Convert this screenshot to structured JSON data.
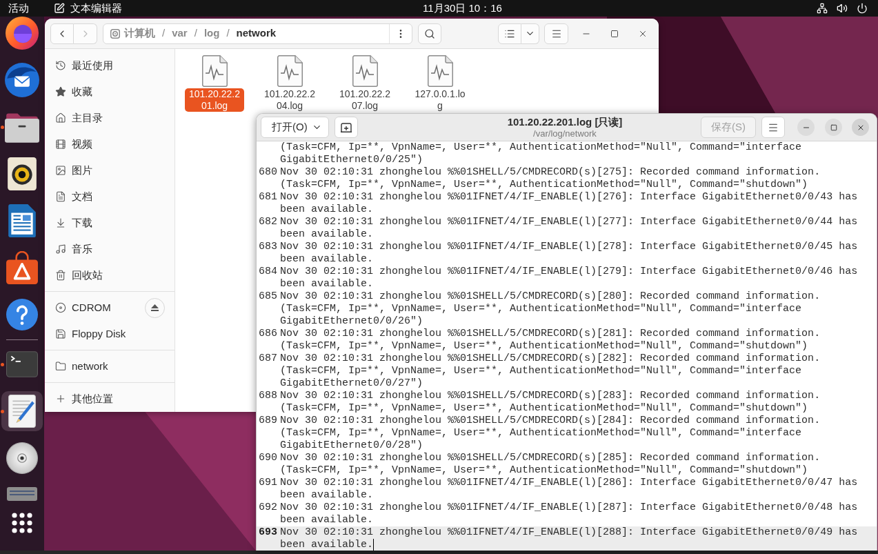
{
  "top_bar": {
    "activities": "活动",
    "app_menu": "文本编辑器",
    "clock": "11月30日 10：16"
  },
  "dock": {
    "groups": [
      {
        "items": [
          {
            "kind": "browser",
            "running": false,
            "selected": false
          },
          {
            "kind": "mail",
            "running": false,
            "selected": false
          },
          {
            "kind": "files",
            "running": true,
            "selected": false
          },
          {
            "kind": "music_player",
            "running": false,
            "selected": false
          },
          {
            "kind": "writer",
            "running": false,
            "selected": false
          },
          {
            "kind": "app_store",
            "running": false,
            "selected": false
          },
          {
            "kind": "help",
            "running": false,
            "selected": false
          }
        ]
      },
      {
        "items": [
          {
            "kind": "terminal",
            "running": true,
            "selected": false
          },
          {
            "kind": "text_editor",
            "running": true,
            "selected": true
          },
          {
            "kind": "disc",
            "running": false,
            "selected": false
          },
          {
            "kind": "drive",
            "running": false,
            "selected": false
          }
        ]
      }
    ]
  },
  "file_manager": {
    "nav_buttons": [
      {
        "kind": "back",
        "disabled": false
      },
      {
        "kind": "forward",
        "disabled": true
      }
    ],
    "path": {
      "segments": [
        {
          "label": "计算机",
          "selected": false
        },
        {
          "label": "var",
          "selected": false
        },
        {
          "label": "log",
          "selected": false
        },
        {
          "label": "network",
          "selected": true
        }
      ],
      "separators": [
        "/",
        "/",
        "/"
      ]
    },
    "sidebar": {
      "places": [
        {
          "kind": "recent",
          "label": "最近使用",
          "selected": false
        },
        {
          "kind": "starred",
          "label": "收藏",
          "selected": false
        },
        {
          "kind": "home",
          "label": "主目录",
          "selected": false
        },
        {
          "kind": "videos",
          "label": "视频",
          "selected": false
        },
        {
          "kind": "pictures",
          "label": "图片",
          "selected": false
        },
        {
          "kind": "documents",
          "label": "文档",
          "selected": false
        },
        {
          "kind": "downloads",
          "label": "下载",
          "selected": false
        },
        {
          "kind": "music",
          "label": "音乐",
          "selected": false
        },
        {
          "kind": "trash",
          "label": "回收站",
          "selected": false
        }
      ],
      "devices": [
        {
          "kind": "cdrom",
          "label": "CDROM",
          "selected": false,
          "ejectable": true
        },
        {
          "kind": "floppy",
          "label": "Floppy Disk",
          "selected": false,
          "ejectable": false
        }
      ],
      "bookmarks": [
        {
          "kind": "folder",
          "label": "network",
          "selected": false
        }
      ],
      "other_locations": [
        {
          "kind": "other",
          "label": "其他位置",
          "selected": false
        }
      ]
    },
    "files": [
      {
        "name": "101.20.22.201.log",
        "selected": true
      },
      {
        "name": "101.20.22.204.log",
        "selected": false
      },
      {
        "name": "101.20.22.207.log",
        "selected": false
      },
      {
        "name": "127.0.0.1.log",
        "selected": false
      }
    ]
  },
  "editor": {
    "open_button": "打开(O)",
    "title": "101.20.22.201.log [只读]",
    "subtitle": "/var/log/network",
    "save_button": {
      "label": "保存(S)",
      "disabled": true
    },
    "lines": [
      {
        "text": "(Task=CFM, Ip=**, VpnName=, User=**, AuthenticationMethod=\"Null\", Command=\"interface GigabitEthernet0/0/25\")",
        "current": false
      },
      {
        "number": "680",
        "text": "Nov 30 02:10:31 zhonghelou %%01SHELL/5/CMDRECORD(s)[275]: Recorded command information. (Task=CFM, Ip=**, VpnName=, User=**, AuthenticationMethod=\"Null\", Command=\"shutdown\")",
        "current": false
      },
      {
        "number": "681",
        "text": "Nov 30 02:10:31 zhonghelou %%01IFNET/4/IF_ENABLE(l)[276]: Interface GigabitEthernet0/0/43 has been available.",
        "current": false
      },
      {
        "number": "682",
        "text": "Nov 30 02:10:31 zhonghelou %%01IFNET/4/IF_ENABLE(l)[277]: Interface GigabitEthernet0/0/44 has been available.",
        "current": false
      },
      {
        "number": "683",
        "text": "Nov 30 02:10:31 zhonghelou %%01IFNET/4/IF_ENABLE(l)[278]: Interface GigabitEthernet0/0/45 has been available.",
        "current": false
      },
      {
        "number": "684",
        "text": "Nov 30 02:10:31 zhonghelou %%01IFNET/4/IF_ENABLE(l)[279]: Interface GigabitEthernet0/0/46 has been available.",
        "current": false
      },
      {
        "number": "685",
        "text": "Nov 30 02:10:31 zhonghelou %%01SHELL/5/CMDRECORD(s)[280]: Recorded command information. (Task=CFM, Ip=**, VpnName=, User=**, AuthenticationMethod=\"Null\", Command=\"interface GigabitEthernet0/0/26\")",
        "current": false
      },
      {
        "number": "686",
        "text": "Nov 30 02:10:31 zhonghelou %%01SHELL/5/CMDRECORD(s)[281]: Recorded command information. (Task=CFM, Ip=**, VpnName=, User=**, AuthenticationMethod=\"Null\", Command=\"shutdown\")",
        "current": false
      },
      {
        "number": "687",
        "text": "Nov 30 02:10:31 zhonghelou %%01SHELL/5/CMDRECORD(s)[282]: Recorded command information. (Task=CFM, Ip=**, VpnName=, User=**, AuthenticationMethod=\"Null\", Command=\"interface GigabitEthernet0/0/27\")",
        "current": false
      },
      {
        "number": "688",
        "text": "Nov 30 02:10:31 zhonghelou %%01SHELL/5/CMDRECORD(s)[283]: Recorded command information. (Task=CFM, Ip=**, VpnName=, User=**, AuthenticationMethod=\"Null\", Command=\"shutdown\")",
        "current": false
      },
      {
        "number": "689",
        "text": "Nov 30 02:10:31 zhonghelou %%01SHELL/5/CMDRECORD(s)[284]: Recorded command information. (Task=CFM, Ip=**, VpnName=, User=**, AuthenticationMethod=\"Null\", Command=\"interface GigabitEthernet0/0/28\")",
        "current": false
      },
      {
        "number": "690",
        "text": "Nov 30 02:10:31 zhonghelou %%01SHELL/5/CMDRECORD(s)[285]: Recorded command information. (Task=CFM, Ip=**, VpnName=, User=**, AuthenticationMethod=\"Null\", Command=\"shutdown\")",
        "current": false
      },
      {
        "number": "691",
        "text": "Nov 30 02:10:31 zhonghelou %%01IFNET/4/IF_ENABLE(l)[286]: Interface GigabitEthernet0/0/47 has been available.",
        "current": false
      },
      {
        "number": "692",
        "text": "Nov 30 02:10:31 zhonghelou %%01IFNET/4/IF_ENABLE(l)[287]: Interface GigabitEthernet0/0/48 has been available.",
        "current": false
      },
      {
        "number": "693",
        "text": "Nov 30 02:10:31 zhonghelou %%01IFNET/4/IF_ENABLE(l)[288]: Interface GigabitEthernet0/0/49 has been available.",
        "current": true
      }
    ]
  }
}
